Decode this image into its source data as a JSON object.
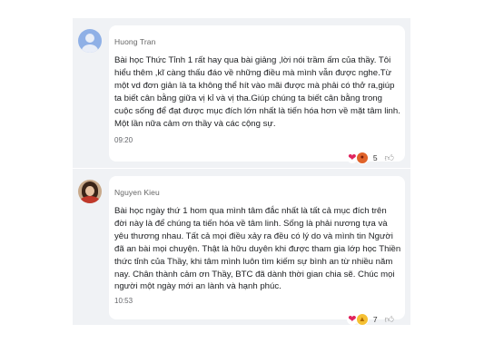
{
  "comments": [
    {
      "author": "Huong Tran",
      "text": "Bài học Thức Tỉnh 1 rất hay qua bài giảng ,lời nói trầm ấm  của thầy. Tôi hiểu thêm ,kĩ càng thấu đáo về những điều mà mình vẫn được nghe.Từ một vd đơn giản là ta không thể hít vào mãi được mà phải có thở ra,giúp ta biết cân bằng giữa vị kỉ và vị tha.Giúp chúng ta biết cân bằng trong cuộc sống để đạt được mục đích lớn nhất là tiến hóa hơn về mặt tâm linh. Một lần nữa cảm ơn thầy và các cộng sự.",
      "time": "09:20",
      "reactions": [
        "heart",
        "angry"
      ],
      "reaction_count": "5"
    },
    {
      "author": "Nguyen Kieu",
      "text": "Bài học ngày thứ 1 hom qua mình tâm đắc nhất là tất cả mục đích trên đời này là để chúng ta tiến hóa về tâm linh. Sống là phải nương tựa và yêu thương nhau. Tất cả mọi điều xảy ra đều có lý do và mình tin Người đã an bài mọi chuyện. Thật là hữu duyên khi được tham gia lớp học Thiền thức tỉnh của Thầy, khi tâm mình luôn tìm kiếm sự bình an từ nhiều năm nay. Chân thành cảm ơn Thầy, BTC đã dành thời gian chia sẽ. Chúc mọi người một ngày mới an lành và hạnh phúc.",
      "time": "10:53",
      "reactions": [
        "heart",
        "like"
      ],
      "reaction_count": "7"
    }
  ],
  "icons": {
    "heart": "heart-icon",
    "angry": "angry-face-icon",
    "like": "thumbs-up-icon",
    "like_button": "thumbs-up-outline-icon"
  },
  "colors": {
    "panel_bg": "#f0f2f5",
    "card_bg": "#ffffff",
    "text": "#1c1e21",
    "meta": "#65676b"
  }
}
